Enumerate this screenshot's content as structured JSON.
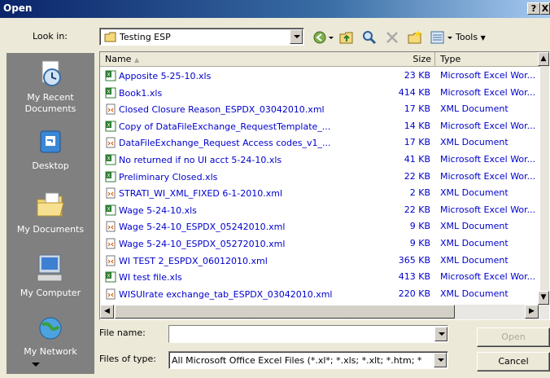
{
  "window": {
    "title": "Open",
    "help_button": "?",
    "close_button": "X"
  },
  "toolbar": {
    "look_in_label": "Look in:",
    "look_in_value": "Testing ESP",
    "tools_label": "Tools"
  },
  "places": [
    {
      "label": "My Recent Documents",
      "icon": "recent-documents-icon"
    },
    {
      "label": "Desktop",
      "icon": "desktop-icon"
    },
    {
      "label": "My Documents",
      "icon": "my-documents-icon"
    },
    {
      "label": "My Computer",
      "icon": "my-computer-icon"
    },
    {
      "label": "My Network",
      "icon": "network-icon"
    }
  ],
  "columns": {
    "name": "Name",
    "size": "Size",
    "type": "Type"
  },
  "files": [
    {
      "name": "Apposite 5-25-10.xls",
      "size": "23 KB",
      "type": "Microsoft Excel Wor...",
      "kind": "xls"
    },
    {
      "name": "Book1.xls",
      "size": "414 KB",
      "type": "Microsoft Excel Wor...",
      "kind": "xls"
    },
    {
      "name": "Closed Closure Reason_ESPDX_03042010.xml",
      "size": "17 KB",
      "type": "XML Document",
      "kind": "xml"
    },
    {
      "name": "Copy of DataFileExchange_RequestTemplate_...",
      "size": "14 KB",
      "type": "Microsoft Excel Wor...",
      "kind": "xls"
    },
    {
      "name": "DataFileExchange_Request Access codes_v1_...",
      "size": "17 KB",
      "type": "XML Document",
      "kind": "xml"
    },
    {
      "name": "No returned if no UI acct 5-24-10.xls",
      "size": "41 KB",
      "type": "Microsoft Excel Wor...",
      "kind": "xls"
    },
    {
      "name": "Preliminary Closed.xls",
      "size": "22 KB",
      "type": "Microsoft Excel Wor...",
      "kind": "xls"
    },
    {
      "name": "STRATI_WI_XML_FIXED 6-1-2010.xml",
      "size": "2 KB",
      "type": "XML Document",
      "kind": "xml"
    },
    {
      "name": "Wage 5-24-10.xls",
      "size": "22 KB",
      "type": "Microsoft Excel Wor...",
      "kind": "xls"
    },
    {
      "name": "Wage 5-24-10_ESPDX_05242010.xml",
      "size": "9 KB",
      "type": "XML Document",
      "kind": "xml"
    },
    {
      "name": "Wage 5-24-10_ESPDX_05272010.xml",
      "size": "9 KB",
      "type": "XML Document",
      "kind": "xml"
    },
    {
      "name": "WI TEST 2_ESPDX_06012010.xml",
      "size": "365 KB",
      "type": "XML Document",
      "kind": "xml"
    },
    {
      "name": "WI test file.xls",
      "size": "413 KB",
      "type": "Microsoft Excel Wor...",
      "kind": "xls"
    },
    {
      "name": "WISUIrate exchange_tab_ESPDX_03042010.xml",
      "size": "220 KB",
      "type": "XML Document",
      "kind": "xml"
    }
  ],
  "bottom": {
    "file_name_label": "File name:",
    "file_name_value": "",
    "file_type_label": "Files of type:",
    "file_type_value": "All Microsoft Office Excel Files (*.xl*; *.xls; *.xlt; *.htm; *",
    "open_label": "Open",
    "cancel_label": "Cancel"
  }
}
